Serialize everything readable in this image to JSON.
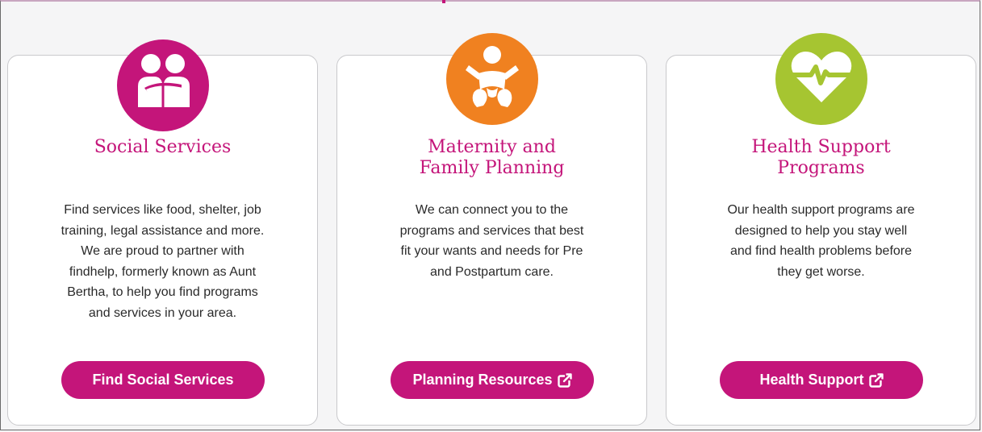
{
  "cards": [
    {
      "title_lines": [
        "Social Services"
      ],
      "description": "Find services like food, shelter, job training, legal assistance and more. We are proud to partner with findhelp, formerly known as Aunt Bertha, to help you find programs and services in your area.",
      "button_label": "Find Social Services",
      "icon": "people-hug-icon",
      "icon_color": "#c4157a",
      "external_link": false
    },
    {
      "title_lines": [
        "Maternity and",
        "Family Planning"
      ],
      "description": "We can connect you to the programs and services that best fit your wants and needs for Pre and Postpartum care.",
      "button_label": "Planning Resources",
      "icon": "baby-icon",
      "icon_color": "#f08120",
      "external_link": true
    },
    {
      "title_lines": [
        "Health Support",
        "Programs"
      ],
      "description": "Our health support programs are designed to help you stay well and find health problems before they get worse.",
      "button_label": "Health Support",
      "icon": "heartbeat-icon",
      "icon_color": "#a6c531",
      "external_link": true
    }
  ],
  "colors": {
    "accent": "#c4157a",
    "button_text": "#ffffff",
    "body_text": "#2a2a2a"
  }
}
